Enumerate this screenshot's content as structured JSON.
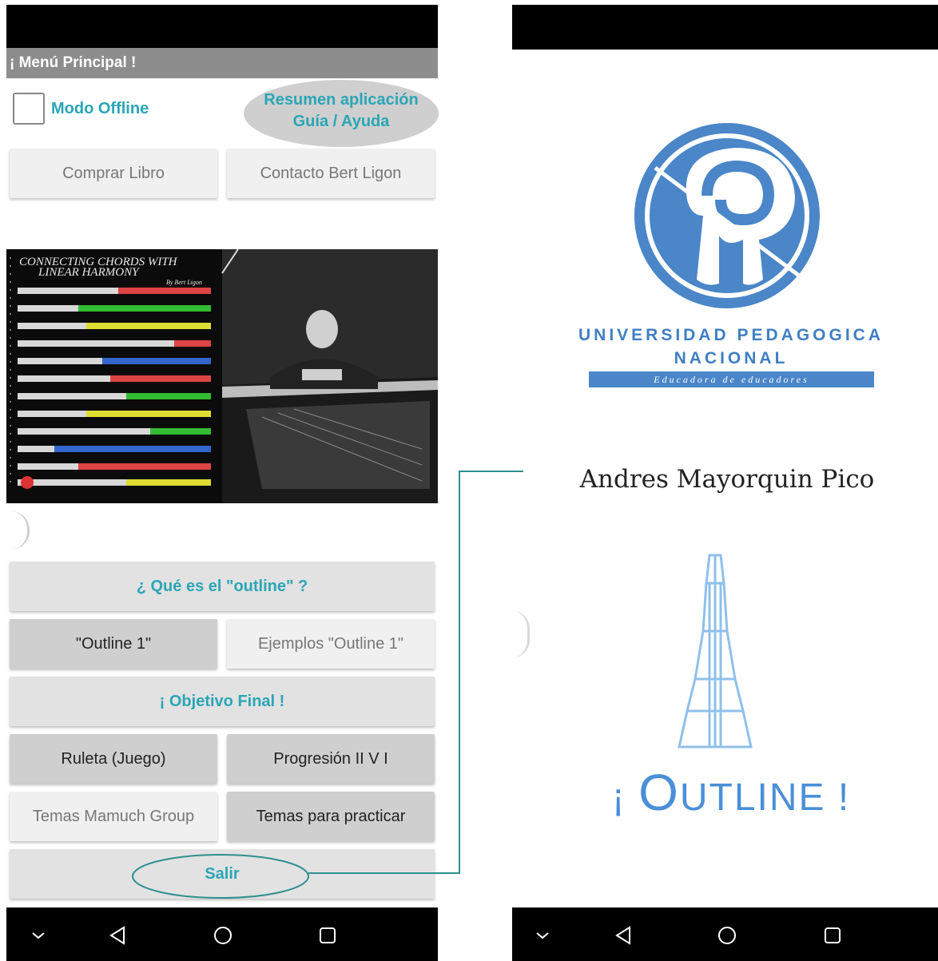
{
  "left_screen": {
    "title": "¡ Menú Principal !",
    "offline_label": "Modo Offline",
    "help": {
      "line1": "Resumen aplicación",
      "line2": "Guía / Ayuda"
    },
    "buy_book": "Comprar Libro",
    "contact": "Contacto Bert Ligon",
    "book": {
      "title_line1": "CONNECTING CHORDS WITH",
      "title_line2": "LINEAR HARMONY",
      "author": "By Bert Ligon"
    },
    "what_outline": "¿ Qué es el \"outline\" ?",
    "outline1": "\"Outline 1\"",
    "examples_outline1": "Ejemplos \"Outline 1\"",
    "final_goal": "¡ Objetivo Final !",
    "roulette": "Ruleta (Juego)",
    "progression": "Progresión II V I",
    "mamuch_topics": "Temas Mamuch Group",
    "practice_topics": "Temas para practicar",
    "exit": "Salir"
  },
  "right_screen": {
    "university_line1": "UNIVERSIDAD PEDAGOGICA",
    "university_line2": "NACIONAL",
    "university_motto": "Educadora de educadores",
    "author": "Andres Mayorquin Pico",
    "app_title_open": "¡ ",
    "app_title_word_o": "O",
    "app_title_word_rest": "UTLINE",
    "app_title_close": " !"
  },
  "nav_icons": [
    "chevron-down-icon",
    "back-icon",
    "home-icon",
    "recents-icon"
  ],
  "colors": {
    "accent": "#2aa6b6",
    "university_blue": "#3f7fc3",
    "outline_blue": "#4a8fd8"
  }
}
